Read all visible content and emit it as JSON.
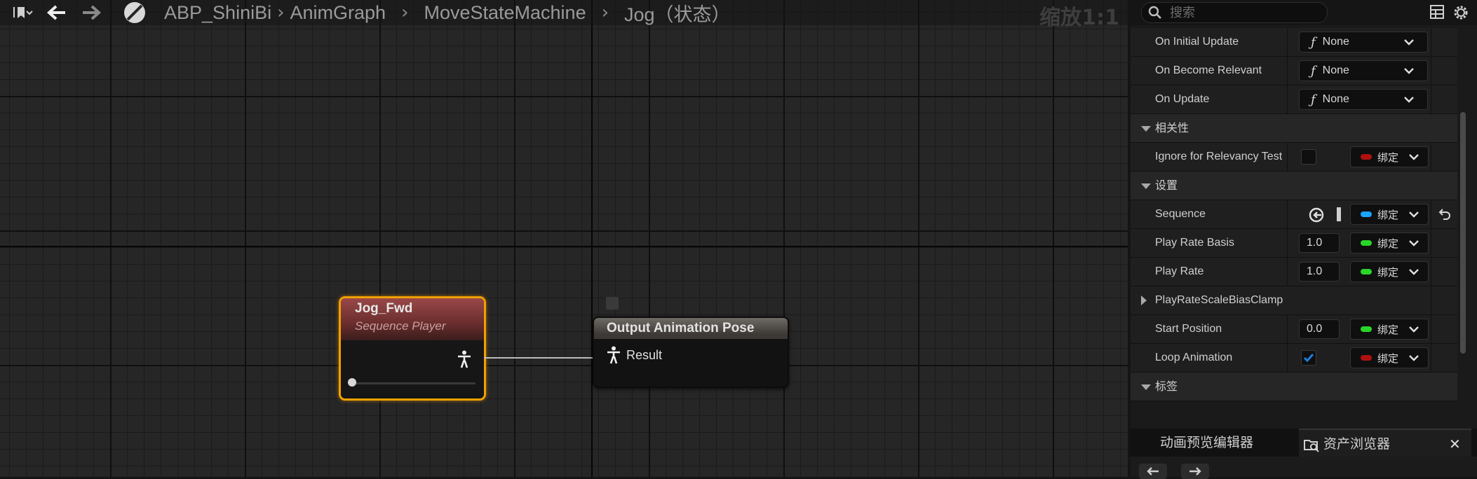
{
  "breadcrumb": {
    "items": [
      "ABP_ShiniBi",
      "AnimGraph",
      "MoveStateMachine",
      "Jog（状态）"
    ],
    "zoom": "缩放1:1"
  },
  "nodes": {
    "sequence_player": {
      "title": "Jog_Fwd",
      "subtitle": "Sequence Player"
    },
    "output_pose": {
      "title": "Output Animation Pose",
      "pin_label": "Result"
    }
  },
  "search": {
    "placeholder": "搜索"
  },
  "details": {
    "function_rows": [
      {
        "name": "On Initial Update",
        "value": "None"
      },
      {
        "name": "On Become Relevant",
        "value": "None"
      },
      {
        "name": "On Update",
        "value": "None"
      }
    ],
    "categories": {
      "relevancy": "相关性",
      "settings": "设置",
      "tags": "标签"
    },
    "ignore_relevancy": {
      "name": "Ignore for Relevancy Test",
      "checked": false,
      "bind_label": "绑定"
    },
    "sequence": {
      "name": "Sequence",
      "bind_label": "绑定"
    },
    "play_rate_basis": {
      "name": "Play Rate Basis",
      "value": "1.0",
      "bind_label": "绑定"
    },
    "play_rate": {
      "name": "Play Rate",
      "value": "1.0",
      "bind_label": "绑定"
    },
    "play_rate_clamp": {
      "name": "PlayRateScaleBiasClamp"
    },
    "start_position": {
      "name": "Start Position",
      "value": "0.0",
      "bind_label": "绑定"
    },
    "loop_animation": {
      "name": "Loop Animation",
      "checked": true,
      "bind_label": "绑定"
    }
  },
  "bottom_tabs": {
    "preview": "动画预览编辑器",
    "assets": "资产浏览器",
    "close": "✕"
  },
  "colors": {
    "node_selected_border": "#f0a000",
    "bind_red": "#b01010",
    "bind_blue": "#1aa3ff",
    "bind_green": "#29d629",
    "checkbox_blue": "#1f7fe0"
  }
}
